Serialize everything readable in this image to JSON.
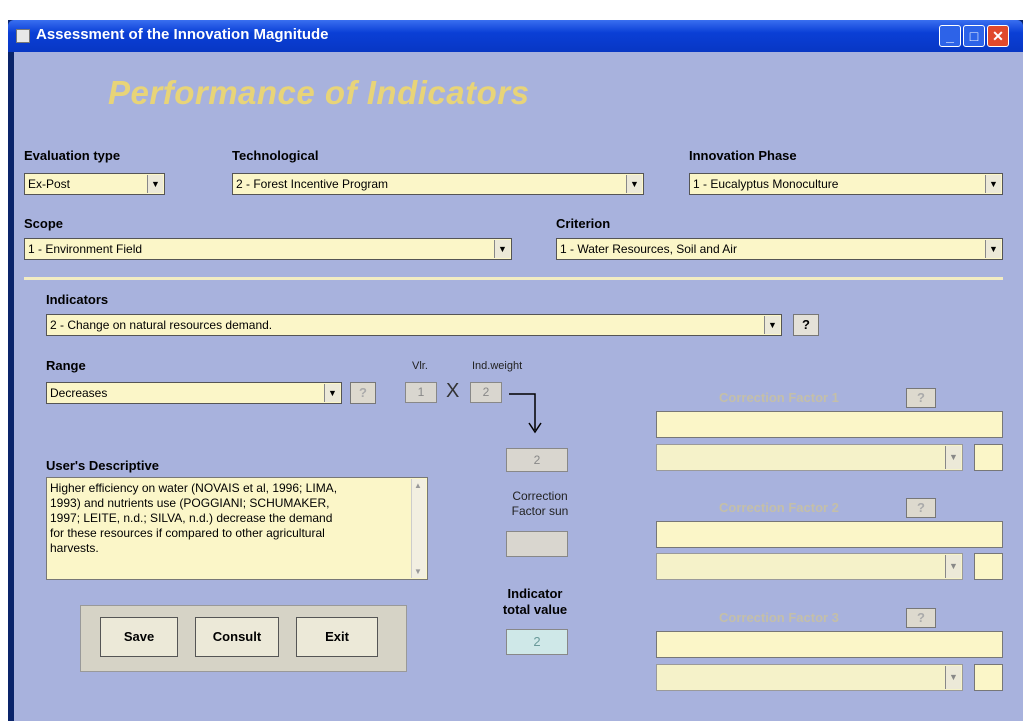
{
  "window": {
    "title": "Assessment of the Innovation Magnitude"
  },
  "heading": "Performance of Indicators",
  "evaluation_type": {
    "label": "Evaluation type",
    "value": "Ex-Post"
  },
  "technological": {
    "label": "Technological",
    "value": "2 - Forest Incentive Program"
  },
  "innovation_phase": {
    "label": "Innovation Phase",
    "value": "1 - Eucalyptus Monoculture"
  },
  "scope": {
    "label": "Scope",
    "value": "1 - Environment Field"
  },
  "criterion": {
    "label": "Criterion",
    "value": "1 - Water Resources, Soil and Air"
  },
  "indicators": {
    "label": "Indicators",
    "value": "2 - Change on natural resources demand.",
    "help": "?"
  },
  "range": {
    "label": "Range",
    "value": "Decreases",
    "help": "?"
  },
  "calc": {
    "vlr_label": "Vlr.",
    "vlr_value": "1",
    "times": "X",
    "weight_label": "Ind.weight",
    "weight_value": "2",
    "result_value": "2",
    "cf_sum_label": "Correction\nFactor sun",
    "cf_sum_value": "",
    "total_label": "Indicator\ntotal value",
    "total_value": "2"
  },
  "description": {
    "label": "User's Descriptive",
    "text": "Higher efficiency on water (NOVAIS et al, 1996; LIMA,\n1993) and nutrients use (POGGIANI; SCHUMAKER,\n1997; LEITE, n.d.; SILVA, n.d.) decrease the demand\nfor these resources if compared to other agricultural\nharvests."
  },
  "buttons": {
    "save": "Save",
    "consult": "Consult",
    "exit": "Exit"
  },
  "correction_factors": [
    {
      "title": "Correction Factor 1",
      "help": "?"
    },
    {
      "title": "Correction Factor 2",
      "help": "?"
    },
    {
      "title": "Correction Factor 3",
      "help": "?"
    }
  ]
}
